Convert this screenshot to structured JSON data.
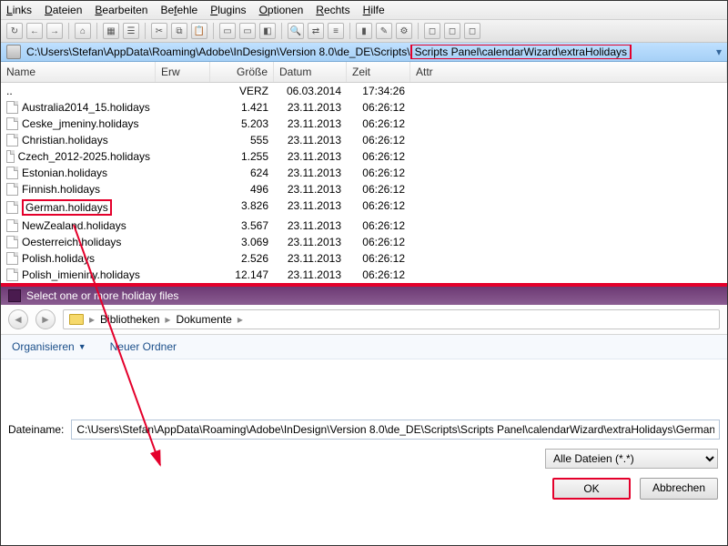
{
  "menu": {
    "links": "Links",
    "dateien": "Dateien",
    "bearbeiten": "Bearbeiten",
    "befehle": "Befehle",
    "plugins": "Plugins",
    "optionen": "Optionen",
    "rechts": "Rechts",
    "hilfe": "Hilfe"
  },
  "address": {
    "prefix": "C:\\Users\\Stefan\\AppData\\Roaming\\Adobe\\InDesign\\Version 8.0\\de_DE\\Scripts\\",
    "highlight": "Scripts Panel\\calendarWizard\\extraHolidays"
  },
  "columns": {
    "name": "Name",
    "erw": "Erw",
    "groesse": "Größe",
    "datum": "Datum",
    "zeit": "Zeit",
    "attr": "Attr"
  },
  "rows": [
    {
      "name": "..",
      "size": "VERZ",
      "date": "06.03.2014",
      "time": "17:34:26",
      "parent": true
    },
    {
      "name": "Australia2014_15.holidays",
      "size": "1.421",
      "date": "23.11.2013",
      "time": "06:26:12"
    },
    {
      "name": "Ceske_jmeniny.holidays",
      "size": "5.203",
      "date": "23.11.2013",
      "time": "06:26:12"
    },
    {
      "name": "Christian.holidays",
      "size": "555",
      "date": "23.11.2013",
      "time": "06:26:12"
    },
    {
      "name": "Czech_2012-2025.holidays",
      "size": "1.255",
      "date": "23.11.2013",
      "time": "06:26:12"
    },
    {
      "name": "Estonian.holidays",
      "size": "624",
      "date": "23.11.2013",
      "time": "06:26:12"
    },
    {
      "name": "Finnish.holidays",
      "size": "496",
      "date": "23.11.2013",
      "time": "06:26:12"
    },
    {
      "name": "German.holidays",
      "size": "3.826",
      "date": "23.11.2013",
      "time": "06:26:12",
      "hl": true
    },
    {
      "name": "NewZealand.holidays",
      "size": "3.567",
      "date": "23.11.2013",
      "time": "06:26:12"
    },
    {
      "name": "Oesterreich.holidays",
      "size": "3.069",
      "date": "23.11.2013",
      "time": "06:26:12"
    },
    {
      "name": "Polish.holidays",
      "size": "2.526",
      "date": "23.11.2013",
      "time": "06:26:12"
    },
    {
      "name": "Polish_imieniny.holidays",
      "size": "12.147",
      "date": "23.11.2013",
      "time": "06:26:12"
    }
  ],
  "dialog": {
    "title": "Select one or more holiday files",
    "bc1": "Bibliotheken",
    "bc2": "Dokumente",
    "organize": "Organisieren",
    "newfolder": "Neuer Ordner",
    "fnamelabel": "Dateiname:",
    "fnamevalue": "C:\\Users\\Stefan\\AppData\\Roaming\\Adobe\\InDesign\\Version 8.0\\de_DE\\Scripts\\Scripts Panel\\calendarWizard\\extraHolidays\\German.holid",
    "filter": "Alle Dateien (*.*)",
    "ok": "OK",
    "cancel": "Abbrechen"
  }
}
